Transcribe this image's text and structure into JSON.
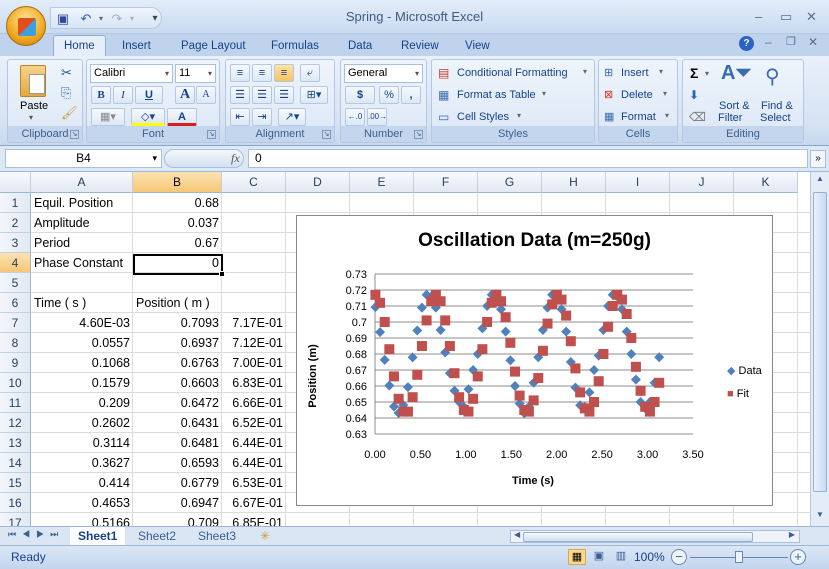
{
  "window": {
    "title": "Spring - Microsoft Excel"
  },
  "quick_access": {
    "save": "save-icon",
    "undo": "undo-icon",
    "redo": "redo-icon",
    "customize": "▾"
  },
  "tabs": [
    "Home",
    "Insert",
    "Page Layout",
    "Formulas",
    "Data",
    "Review",
    "View"
  ],
  "active_tab": "Home",
  "ribbon": {
    "clipboard": {
      "label": "Clipboard",
      "paste": "Paste"
    },
    "font": {
      "label": "Font",
      "font_name": "Calibri",
      "font_size": "11",
      "bold": "B",
      "italic": "I",
      "underline": "U",
      "grow": "A",
      "shrink": "A",
      "font_color": "A"
    },
    "alignment": {
      "label": "Alignment"
    },
    "number": {
      "label": "Number",
      "format": "General",
      "currency": "$",
      "percent": "%",
      "comma": ",",
      "inc_decimal": "←.0 .00",
      "dec_decimal": ".00 →.0"
    },
    "styles": {
      "label": "Styles",
      "conditional": "Conditional Formatting",
      "format_table": "Format as Table",
      "cell_styles": "Cell Styles"
    },
    "cells": {
      "label": "Cells",
      "insert": "Insert",
      "delete": "Delete",
      "format": "Format"
    },
    "editing": {
      "label": "Editing",
      "sum": "Σ",
      "sort": "Sort &",
      "sort2": "Filter",
      "find": "Find &",
      "find2": "Select"
    }
  },
  "formula_bar": {
    "name_box": "B4",
    "fx": "fx",
    "value": "0"
  },
  "columns": [
    "A",
    "B",
    "C",
    "D",
    "E",
    "F",
    "G",
    "H",
    "I",
    "J",
    "K"
  ],
  "selected_column": "B",
  "selected_row": "4",
  "rows": [
    {
      "n": "1",
      "a": "Equil. Position",
      "b": "0.68",
      "c": ""
    },
    {
      "n": "2",
      "a": "Amplitude",
      "b": "0.037",
      "c": ""
    },
    {
      "n": "3",
      "a": "Period",
      "b": "0.67",
      "c": ""
    },
    {
      "n": "4",
      "a": "Phase Constant",
      "b": "0",
      "c": ""
    },
    {
      "n": "5",
      "a": "",
      "b": "",
      "c": ""
    },
    {
      "n": "6",
      "a": "Time ( s )",
      "b": "Position ( m )",
      "c": ""
    },
    {
      "n": "7",
      "a": "4.60E-03",
      "b": "0.7093",
      "c": "7.17E-01"
    },
    {
      "n": "8",
      "a": "0.0557",
      "b": "0.6937",
      "c": "7.12E-01"
    },
    {
      "n": "9",
      "a": "0.1068",
      "b": "0.6763",
      "c": "7.00E-01"
    },
    {
      "n": "10",
      "a": "0.1579",
      "b": "0.6603",
      "c": "6.83E-01"
    },
    {
      "n": "11",
      "a": "0.209",
      "b": "0.6472",
      "c": "6.66E-01"
    },
    {
      "n": "12",
      "a": "0.2602",
      "b": "0.6431",
      "c": "6.52E-01"
    },
    {
      "n": "13",
      "a": "0.3114",
      "b": "0.6481",
      "c": "6.44E-01"
    },
    {
      "n": "14",
      "a": "0.3627",
      "b": "0.6593",
      "c": "6.44E-01"
    },
    {
      "n": "15",
      "a": "0.414",
      "b": "0.6779",
      "c": "6.53E-01"
    },
    {
      "n": "16",
      "a": "0.4653",
      "b": "0.6947",
      "c": "6.67E-01"
    },
    {
      "n": "17",
      "a": "0.5166",
      "b": "0.709",
      "c": "6.85E-01"
    }
  ],
  "sheets": [
    "Sheet1",
    "Sheet2",
    "Sheet3"
  ],
  "active_sheet": "Sheet1",
  "status": {
    "text": "Ready",
    "zoom": "100%",
    "zoom_fraction": 0.5
  },
  "chart_data": {
    "type": "scatter",
    "title": "Oscillation Data (m=250g)",
    "xlabel": "Time (s)",
    "ylabel": "Position (m)",
    "xlim": [
      0,
      3.5
    ],
    "ylim": [
      0.63,
      0.73
    ],
    "xticks": [
      "0.00",
      "0.50",
      "1.00",
      "1.50",
      "2.00",
      "2.50",
      "3.00",
      "3.50"
    ],
    "yticks": [
      "0.63",
      "0.64",
      "0.65",
      "0.66",
      "0.67",
      "0.68",
      "0.69",
      "0.7",
      "0.71",
      "0.72",
      "0.73"
    ],
    "grid": "horizontal",
    "legend": "right",
    "series": [
      {
        "name": "Data",
        "marker": "diamond",
        "color": "#4f81bd",
        "x": [
          0.0046,
          0.0557,
          0.1068,
          0.1579,
          0.209,
          0.2602,
          0.3114,
          0.3627,
          0.414,
          0.4653,
          0.5166,
          0.568,
          0.619,
          0.67,
          0.722,
          0.773,
          0.824,
          0.875,
          0.926,
          0.978,
          1.029,
          1.08,
          1.131,
          1.182,
          1.234,
          1.285,
          1.336,
          1.387,
          1.438,
          1.49,
          1.541,
          1.592,
          1.643,
          1.694,
          1.746,
          1.797,
          1.848,
          1.899,
          1.95,
          2.002,
          2.053,
          2.104,
          2.155,
          2.206,
          2.258,
          2.309,
          2.36,
          2.411,
          2.462,
          2.514,
          2.565,
          2.616,
          2.667,
          2.718,
          2.77,
          2.821,
          2.872,
          2.923,
          2.974,
          3.026,
          3.077,
          3.128
        ],
        "y": [
          0.7093,
          0.6937,
          0.6763,
          0.6603,
          0.6472,
          0.6431,
          0.6481,
          0.6593,
          0.6779,
          0.6947,
          0.709,
          0.717,
          0.716,
          0.709,
          0.695,
          0.681,
          0.668,
          0.657,
          0.65,
          0.647,
          0.658,
          0.67,
          0.68,
          0.696,
          0.71,
          0.717,
          0.717,
          0.708,
          0.694,
          0.676,
          0.66,
          0.649,
          0.643,
          0.647,
          0.662,
          0.678,
          0.695,
          0.709,
          0.717,
          0.716,
          0.708,
          0.694,
          0.675,
          0.659,
          0.648,
          0.647,
          0.656,
          0.67,
          0.679,
          0.695,
          0.71,
          0.717,
          0.716,
          0.708,
          0.694,
          0.68,
          0.664,
          0.65,
          0.646,
          0.65,
          0.662,
          0.678,
          0.695
        ]
      },
      {
        "name": "Fit",
        "marker": "square",
        "color": "#c0504d",
        "x": [
          0.0046,
          0.0557,
          0.1068,
          0.1579,
          0.209,
          0.2602,
          0.3114,
          0.3627,
          0.414,
          0.4653,
          0.5166,
          0.568,
          0.619,
          0.67,
          0.722,
          0.773,
          0.824,
          0.875,
          0.926,
          0.978,
          1.029,
          1.08,
          1.131,
          1.182,
          1.234,
          1.285,
          1.336,
          1.387,
          1.438,
          1.49,
          1.541,
          1.592,
          1.643,
          1.694,
          1.746,
          1.797,
          1.848,
          1.899,
          1.95,
          2.002,
          2.053,
          2.104,
          2.155,
          2.206,
          2.258,
          2.309,
          2.36,
          2.411,
          2.462,
          2.514,
          2.565,
          2.616,
          2.667,
          2.718,
          2.77,
          2.821,
          2.872,
          2.923,
          2.974,
          3.026,
          3.077,
          3.128
        ],
        "y": [
          0.717,
          0.712,
          0.7,
          0.683,
          0.666,
          0.652,
          0.644,
          0.644,
          0.653,
          0.667,
          0.685,
          0.701,
          0.713,
          0.717,
          0.713,
          0.701,
          0.685,
          0.668,
          0.653,
          0.645,
          0.644,
          0.652,
          0.666,
          0.683,
          0.7,
          0.712,
          0.717,
          0.713,
          0.703,
          0.687,
          0.669,
          0.654,
          0.645,
          0.644,
          0.651,
          0.665,
          0.682,
          0.699,
          0.711,
          0.717,
          0.714,
          0.704,
          0.688,
          0.671,
          0.656,
          0.646,
          0.644,
          0.65,
          0.663,
          0.68,
          0.697,
          0.71,
          0.717,
          0.714,
          0.705,
          0.69,
          0.672,
          0.657,
          0.647,
          0.644,
          0.65,
          0.662
        ]
      }
    ]
  }
}
